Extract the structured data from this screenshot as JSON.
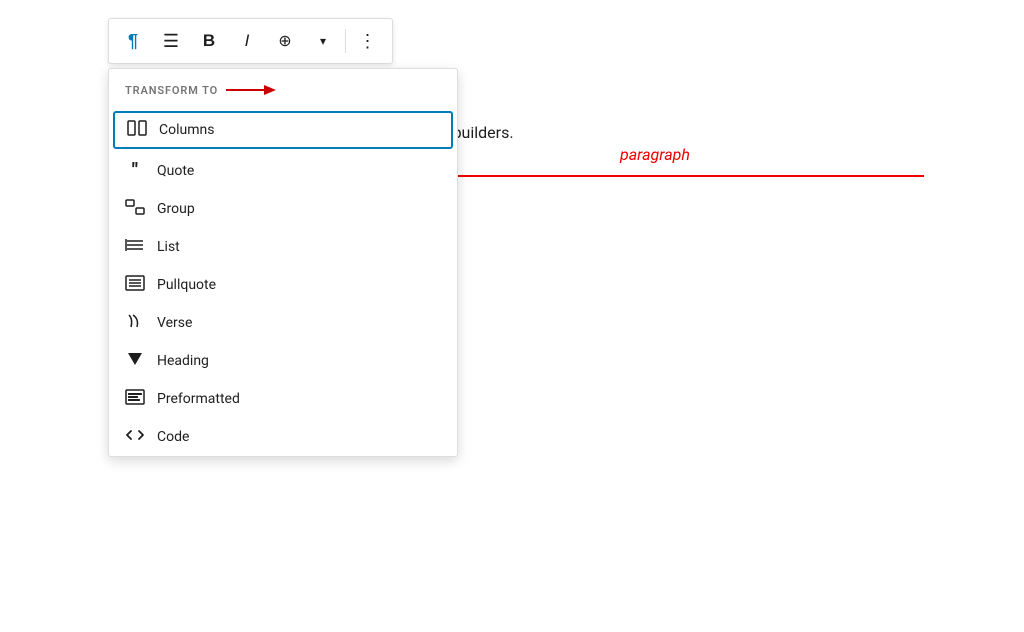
{
  "toolbar": {
    "paragraph_icon": "¶",
    "align_icon": "≡",
    "bold_icon": "B",
    "italic_icon": "I",
    "link_icon": "⊕",
    "chevron_icon": "∨",
    "more_icon": "⋮"
  },
  "transform": {
    "header": "TRANSFORM TO",
    "items": [
      {
        "id": "columns",
        "label": "Columns",
        "icon": "columns"
      },
      {
        "id": "quote",
        "label": "Quote",
        "icon": "quote"
      },
      {
        "id": "group",
        "label": "Group",
        "icon": "group"
      },
      {
        "id": "list",
        "label": "List",
        "icon": "list"
      },
      {
        "id": "pullquote",
        "label": "Pullquote",
        "icon": "pullquote"
      },
      {
        "id": "verse",
        "label": "Verse",
        "icon": "verse"
      },
      {
        "id": "heading",
        "label": "Heading",
        "icon": "heading"
      },
      {
        "id": "preformatted",
        "label": "Preformatted",
        "icon": "preformatted"
      },
      {
        "id": "code",
        "label": "Code",
        "icon": "code"
      }
    ]
  },
  "editor": {
    "content": "st widely used premium themes and visual page builders."
  },
  "annotation": {
    "label": "paragraph"
  }
}
